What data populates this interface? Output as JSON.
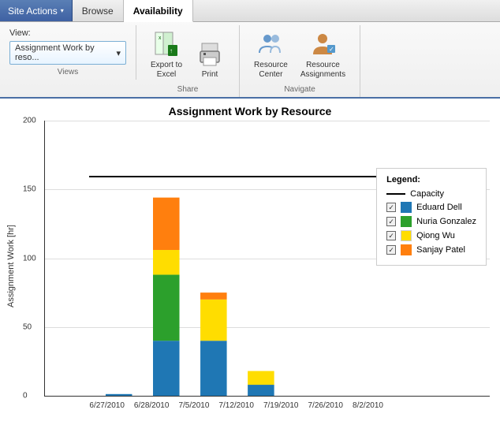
{
  "nav": {
    "site_actions_label": "Site Actions",
    "browse_label": "Browse",
    "availability_label": "Availability"
  },
  "ribbon": {
    "views_label": "View:",
    "views_select_value": "Assignment Work by reso...",
    "views_group_label": "Views",
    "export_label": "Export to\nExcel",
    "print_label": "Print",
    "resource_center_label": "Resource\nCenter",
    "resource_assignments_label": "Resource\nAssignments",
    "share_group_label": "Share",
    "navigate_group_label": "Navigate"
  },
  "chart": {
    "title": "Assignment Work by Resource",
    "y_axis_label": "Assignment Work [hr]",
    "y_ticks": [
      "200",
      "150",
      "100",
      "50",
      "0"
    ],
    "x_labels": [
      "6/27/2010",
      "6/28/2010",
      "7/5/2010",
      "7/12/2010",
      "7/19/2010",
      "7/26/2010",
      "8/2/2010"
    ],
    "capacity_value": 160,
    "capacity_y_pct": 80,
    "bars": [
      {
        "date": "6/27/2010",
        "segments": [
          {
            "color": "#1f77b4",
            "value": 1,
            "pct": 0.5
          },
          {
            "color": "#2ca02c",
            "value": 0,
            "pct": 0
          },
          {
            "color": "#ffdd00",
            "value": 0,
            "pct": 0
          },
          {
            "color": "#ff7f0e",
            "value": 0,
            "pct": 0
          }
        ]
      },
      {
        "date": "6/28/2010",
        "segments": [
          {
            "color": "#1f77b4",
            "value": 40,
            "pct": 20
          },
          {
            "color": "#2ca02c",
            "value": 48,
            "pct": 24
          },
          {
            "color": "#ffdd00",
            "value": 18,
            "pct": 9
          },
          {
            "color": "#ff7f0e",
            "value": 38,
            "pct": 19
          }
        ]
      },
      {
        "date": "7/5/2010",
        "segments": [
          {
            "color": "#1f77b4",
            "value": 40,
            "pct": 20
          },
          {
            "color": "#2ca02c",
            "value": 0,
            "pct": 0
          },
          {
            "color": "#ffdd00",
            "value": 30,
            "pct": 15
          },
          {
            "color": "#ff7f0e",
            "value": 5,
            "pct": 2.5
          }
        ]
      },
      {
        "date": "7/12/2010",
        "segments": [
          {
            "color": "#1f77b4",
            "value": 8,
            "pct": 4
          },
          {
            "color": "#2ca02c",
            "value": 0,
            "pct": 0
          },
          {
            "color": "#ffdd00",
            "value": 10,
            "pct": 5
          },
          {
            "color": "#ff7f0e",
            "value": 0,
            "pct": 0
          }
        ]
      },
      {
        "date": "7/19/2010",
        "segments": [
          {
            "color": "#1f77b4",
            "value": 0,
            "pct": 0
          },
          {
            "color": "#2ca02c",
            "value": 0,
            "pct": 0
          },
          {
            "color": "#ffdd00",
            "value": 0,
            "pct": 0
          },
          {
            "color": "#ff7f0e",
            "value": 0,
            "pct": 0
          }
        ]
      },
      {
        "date": "7/26/2010",
        "segments": [
          {
            "color": "#1f77b4",
            "value": 0,
            "pct": 0
          },
          {
            "color": "#2ca02c",
            "value": 0,
            "pct": 0
          },
          {
            "color": "#ffdd00",
            "value": 0,
            "pct": 0
          },
          {
            "color": "#ff7f0e",
            "value": 0,
            "pct": 0
          }
        ]
      },
      {
        "date": "8/2/2010",
        "segments": [
          {
            "color": "#1f77b4",
            "value": 0,
            "pct": 0
          },
          {
            "color": "#2ca02c",
            "value": 0,
            "pct": 0
          },
          {
            "color": "#ffdd00",
            "value": 0,
            "pct": 0
          },
          {
            "color": "#ff7f0e",
            "value": 0,
            "pct": 0
          }
        ]
      }
    ],
    "legend": {
      "title": "Legend:",
      "items": [
        {
          "type": "line",
          "label": "Capacity"
        },
        {
          "type": "color",
          "color": "#1f77b4",
          "label": "Eduard Dell"
        },
        {
          "type": "color",
          "color": "#2ca02c",
          "label": "Nuria Gonzalez"
        },
        {
          "type": "color",
          "color": "#ffdd00",
          "label": "Qiong Wu"
        },
        {
          "type": "color",
          "color": "#ff7f0e",
          "label": "Sanjay Patel"
        }
      ]
    }
  }
}
